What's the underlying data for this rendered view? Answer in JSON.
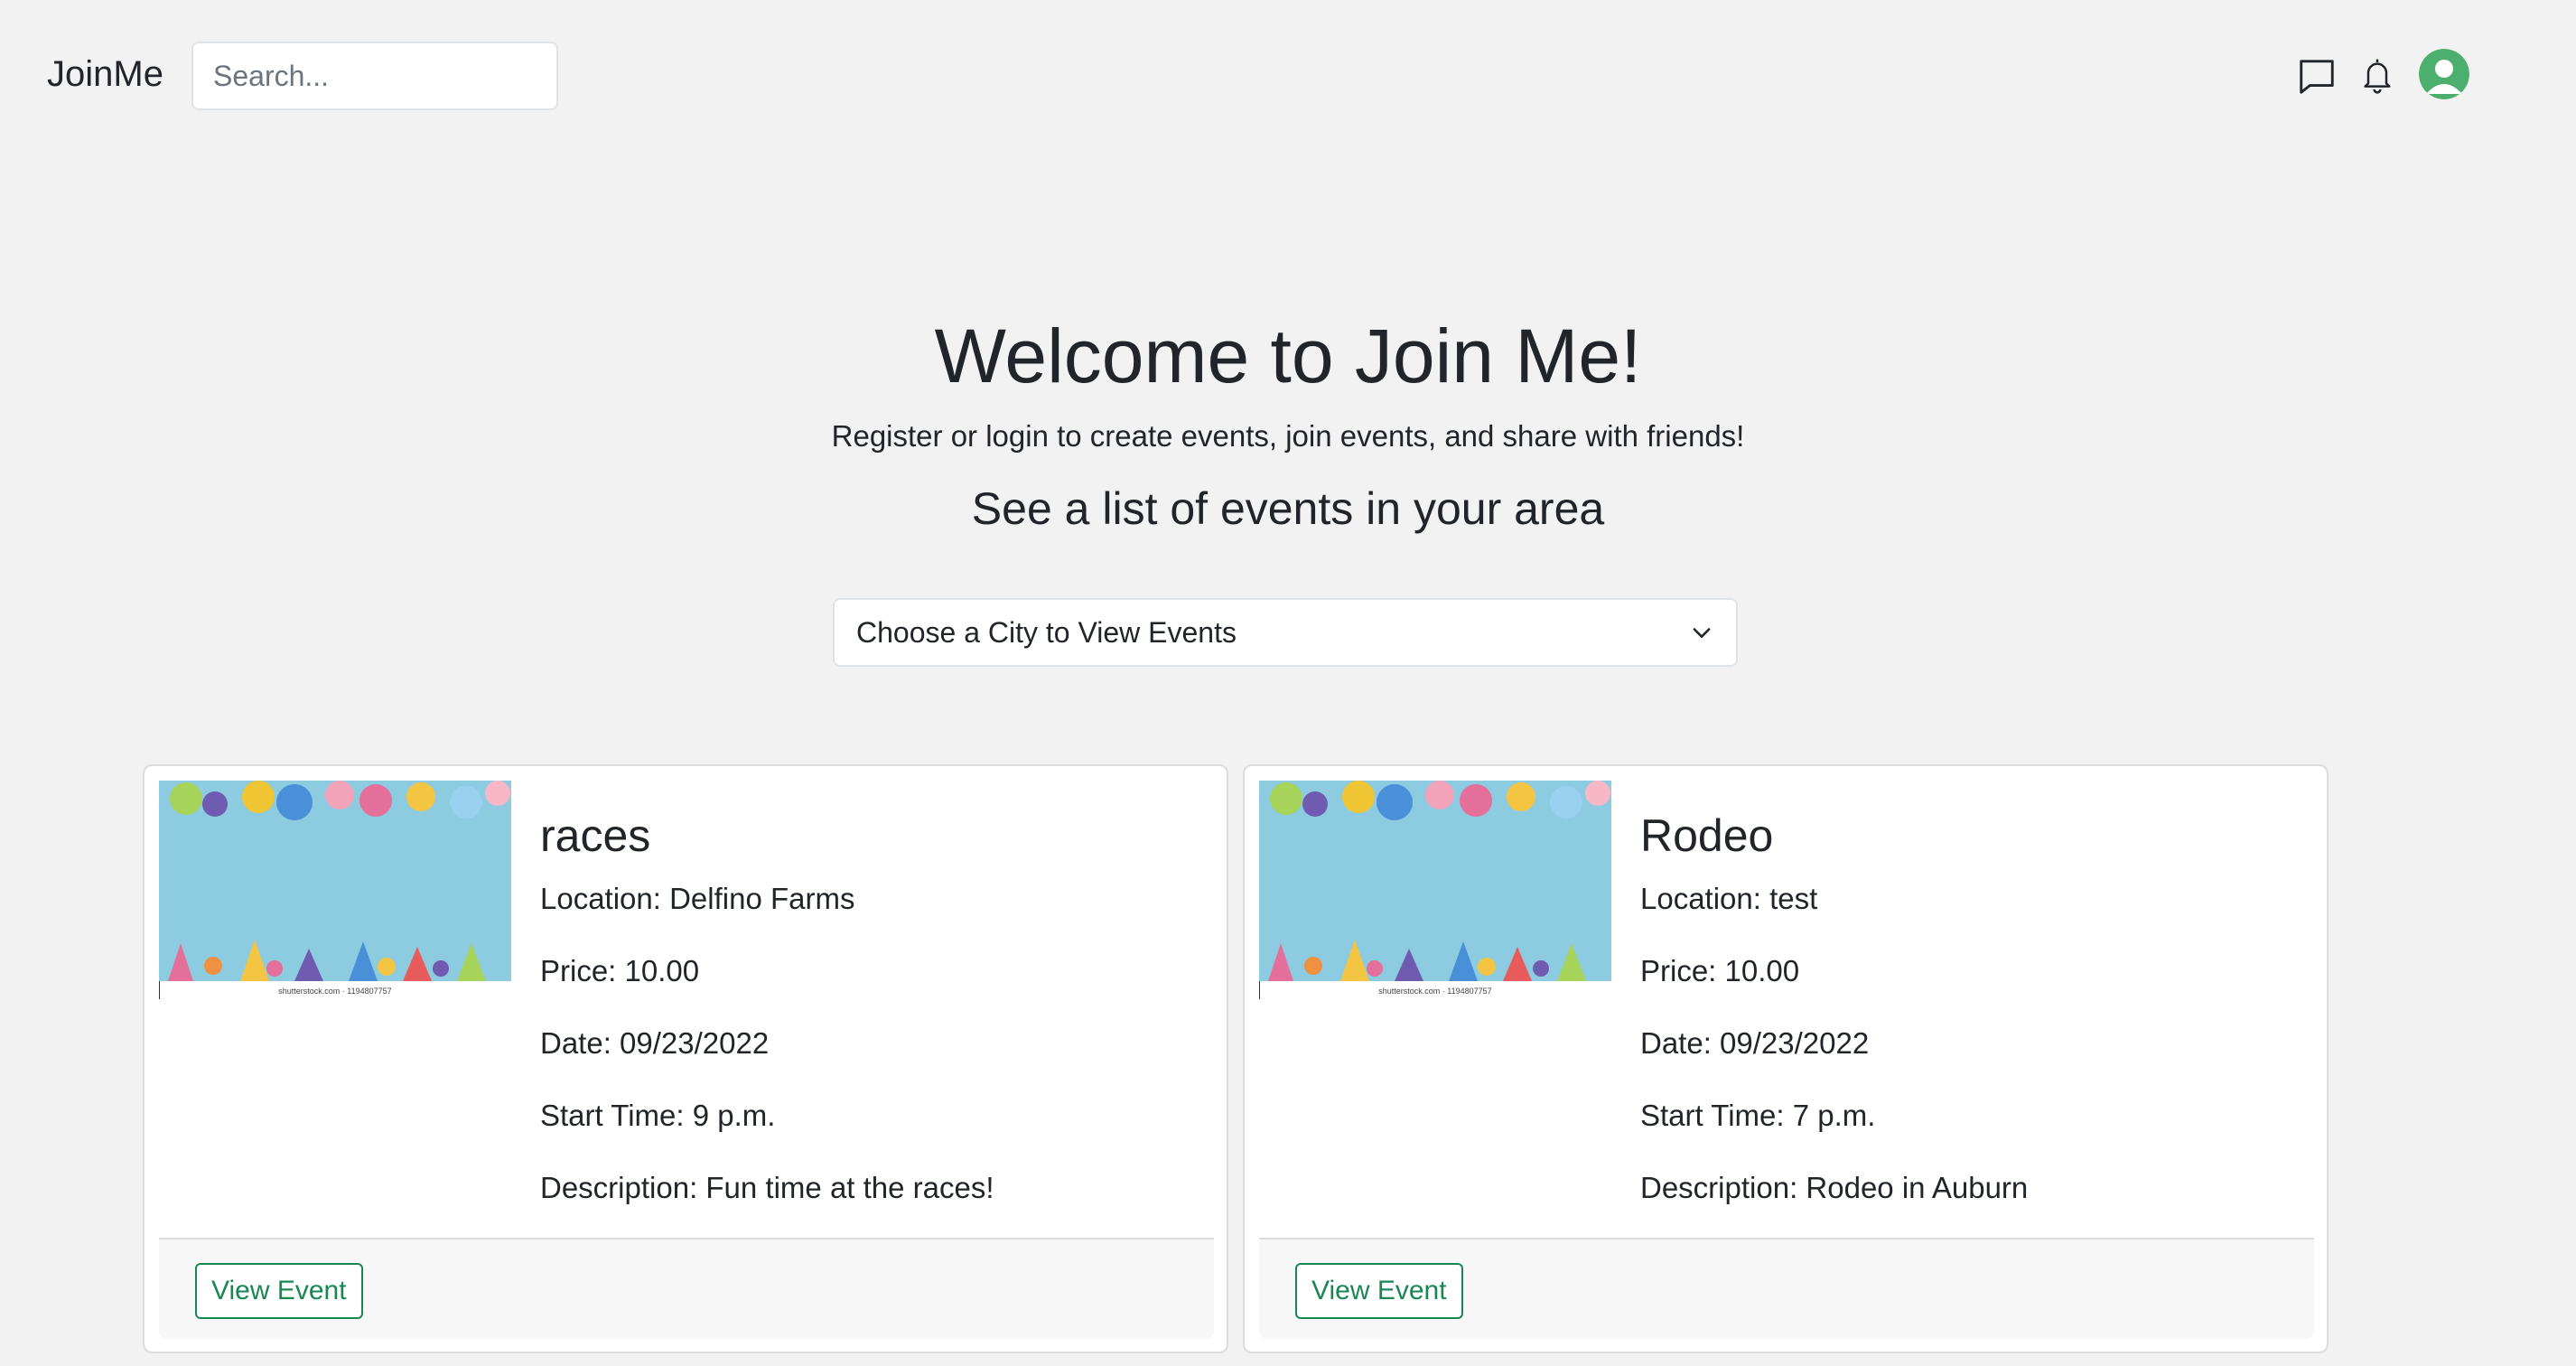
{
  "navbar": {
    "brand": "JoinMe",
    "search_placeholder": "Search...",
    "icons": [
      "message-icon",
      "bell-icon",
      "user-avatar-icon"
    ]
  },
  "hero": {
    "title": "Welcome to Join Me!",
    "subtitle": "Register or login to create events, join events, and share with friends!",
    "heading": "See a list of events in your area",
    "city_select": "Choose a City to View Events"
  },
  "events": [
    {
      "title": "races",
      "location": "Location: Delfino Farms",
      "price": "Price: 10.00",
      "date": "Date: 09/23/2022",
      "start_time": "Start Time: 9 p.m.",
      "description": "Description: Fun time at the races!",
      "image_caption": "shutterstock.com · 1194807757",
      "button": "View Event"
    },
    {
      "title": "Rodeo",
      "location": "Location: test",
      "price": "Price: 10.00",
      "date": "Date: 09/23/2022",
      "start_time": "Start Time: 7 p.m.",
      "description": "Description: Rodeo in Auburn",
      "image_caption": "shutterstock.com · 1194807757",
      "button": "View Event"
    }
  ],
  "colors": {
    "background": "#f2f2f2",
    "accent_green": "#198754",
    "avatar_green": "#4caf6e",
    "banner_blue": "#8ccbe0"
  }
}
